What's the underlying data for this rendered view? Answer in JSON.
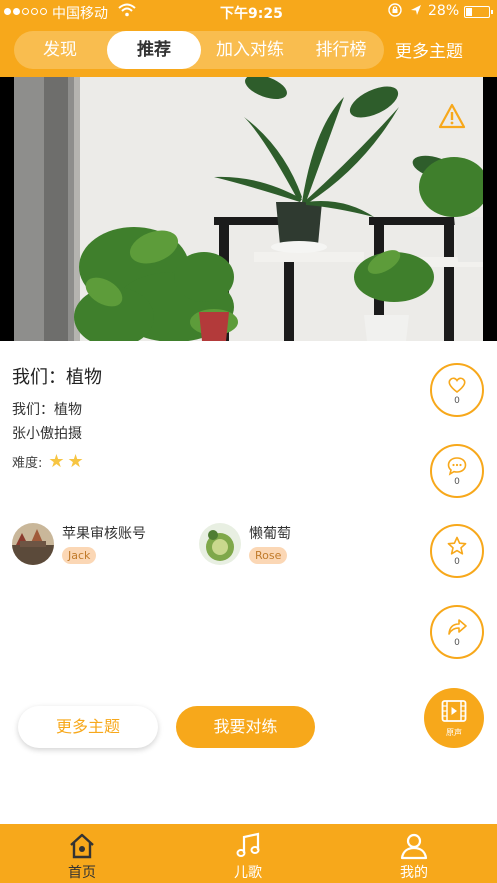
{
  "status_bar": {
    "carrier": "中国移动",
    "time": "下午9:25",
    "battery": "28%",
    "battery_level": 0.28
  },
  "header": {
    "tabs": [
      {
        "label": "发现"
      },
      {
        "label": "推荐",
        "active": true
      },
      {
        "label": "加入对练"
      },
      {
        "label": "排行榜"
      }
    ],
    "more_topics": "更多主题"
  },
  "content": {
    "title": "我们：植物",
    "subtitle": "我们：植物",
    "author": "张小傲拍摄",
    "difficulty_label": "难度:",
    "difficulty_stars": 2,
    "users": [
      {
        "name": "苹果审核账号",
        "tag": "Jack"
      },
      {
        "name": "懒葡萄",
        "tag": "Rose"
      }
    ]
  },
  "actions": {
    "like_count": "0",
    "comment_count": "0",
    "favorite_count": "0",
    "share_count": "0",
    "dub_label": "原声"
  },
  "buttons": {
    "more_topics": "更多主题",
    "practice": "我要对练"
  },
  "tabbar": {
    "items": [
      {
        "label": "首页",
        "icon": "home-icon",
        "active": true
      },
      {
        "label": "儿歌",
        "icon": "music-icon"
      },
      {
        "label": "我的",
        "icon": "profile-icon"
      }
    ]
  },
  "colors": {
    "accent": "#f7a81b",
    "tab_pill": "#f9bd4f",
    "tag_bg": "#fbd7b5",
    "star": "#f7c542"
  }
}
